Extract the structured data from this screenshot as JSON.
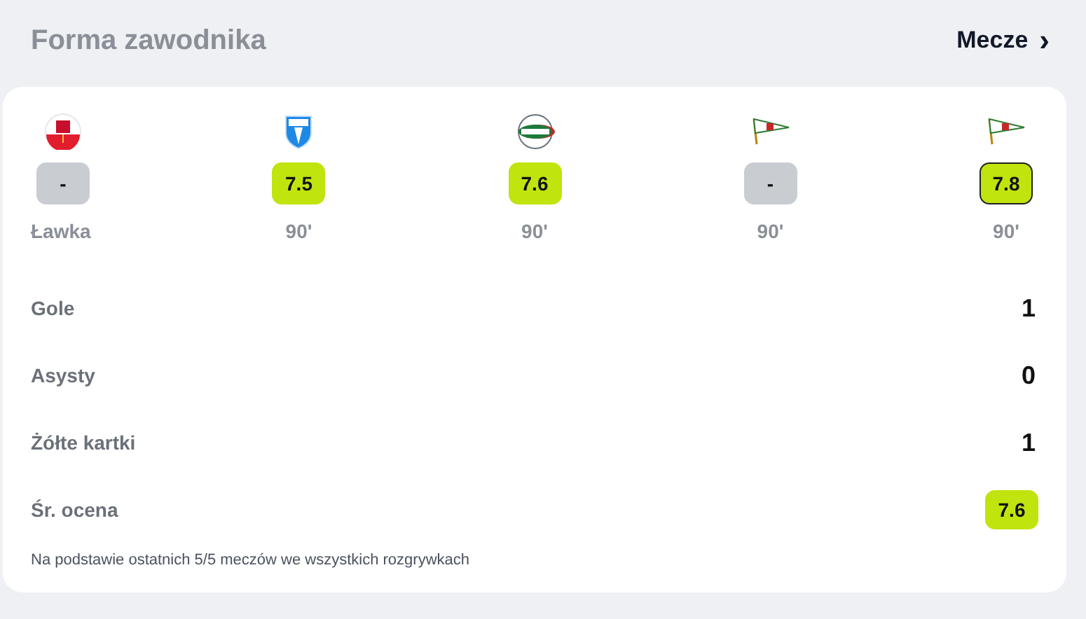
{
  "header": {
    "title": "Forma zawodnika",
    "link": "Mecze",
    "link_icon": "›"
  },
  "matches": [
    {
      "kind": "flag-round",
      "rating": "-",
      "rated": false,
      "selected": false,
      "minutes": "Ławka"
    },
    {
      "kind": "shield",
      "rating": "7.5",
      "rated": true,
      "selected": false,
      "minutes": "90'"
    },
    {
      "kind": "round-crest",
      "rating": "7.6",
      "rated": true,
      "selected": false,
      "minutes": "90'"
    },
    {
      "kind": "pennant",
      "rating": "-",
      "rated": false,
      "selected": false,
      "minutes": "90'"
    },
    {
      "kind": "pennant",
      "rating": "7.8",
      "rated": true,
      "selected": true,
      "minutes": "90'"
    }
  ],
  "stats": [
    {
      "kind": "plain",
      "label": "Gole",
      "value": "1"
    },
    {
      "kind": "plain",
      "label": "Asysty",
      "value": "0"
    },
    {
      "kind": "plain",
      "label": "Żółte kartki",
      "value": "1"
    },
    {
      "kind": "rating",
      "label": "Śr. ocena",
      "value": "7.6"
    }
  ],
  "footnote": "Na podstawie ostatnich 5/5 meczów we wszystkich rozgrywkach"
}
